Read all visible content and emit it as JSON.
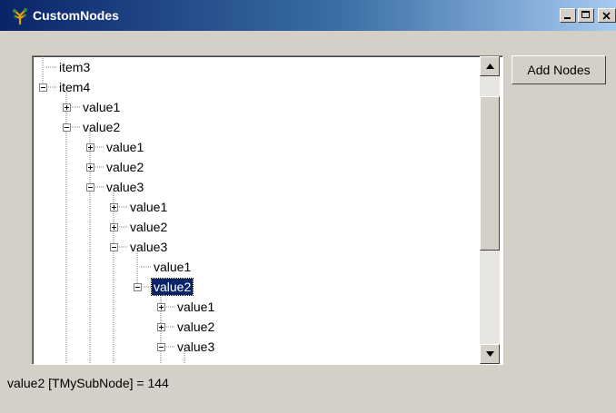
{
  "window": {
    "title": "CustomNodes"
  },
  "tree": {
    "nodes": [
      {
        "label": "item3",
        "expander": "none"
      },
      {
        "label": "item4",
        "expander": "minus"
      },
      {
        "label": "value1",
        "expander": "plus"
      },
      {
        "label": "value2",
        "expander": "minus"
      },
      {
        "label": "value1",
        "expander": "plus"
      },
      {
        "label": "value2",
        "expander": "plus"
      },
      {
        "label": "value3",
        "expander": "minus"
      },
      {
        "label": "value1",
        "expander": "plus"
      },
      {
        "label": "value2",
        "expander": "plus"
      },
      {
        "label": "value3",
        "expander": "minus"
      },
      {
        "label": "value1",
        "expander": "none"
      },
      {
        "label": "value2",
        "expander": "minus",
        "selected": true
      },
      {
        "label": "value1",
        "expander": "plus"
      },
      {
        "label": "value2",
        "expander": "plus"
      },
      {
        "label": "value3",
        "expander": "minus"
      }
    ]
  },
  "toolbar": {
    "add_nodes_label": "Add Nodes"
  },
  "status": {
    "text": "value2 [TMySubNode] = 144"
  },
  "colors": {
    "titlebar_start": "#0a246a",
    "titlebar_end": "#a6caf0",
    "selection": "#0a246a",
    "face": "#d4d0c8"
  }
}
